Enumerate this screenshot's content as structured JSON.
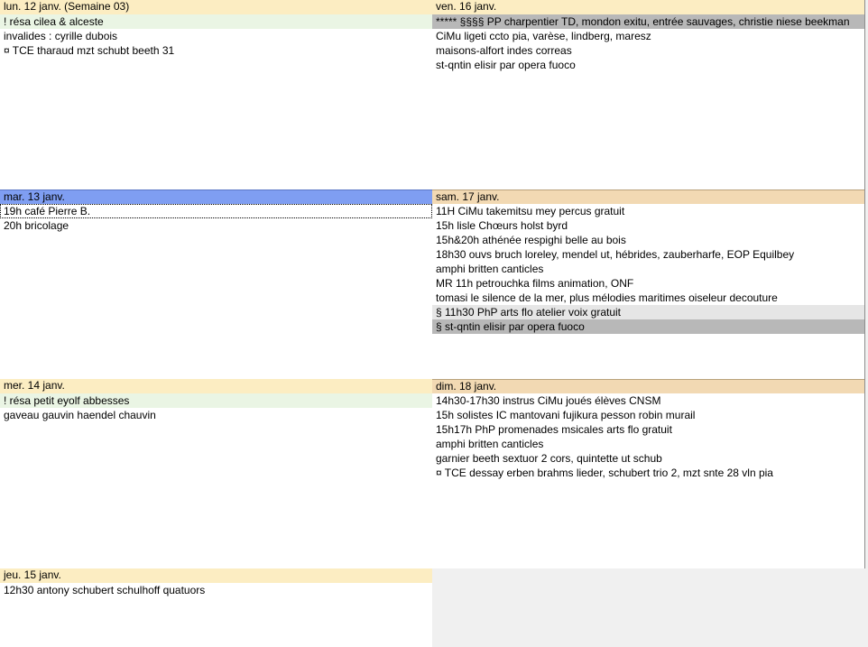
{
  "days": [
    {
      "header": "lun. 12 janv. (Semaine 03)",
      "events": [
        {
          "text": "! résa cilea & alceste",
          "style": "green"
        },
        {
          "text": "invalides : cyrille dubois",
          "style": ""
        },
        {
          "text": "¤ TCE tharaud mzt schubt beeth 31",
          "style": ""
        }
      ]
    },
    {
      "header": "mar. 13 janv.",
      "events": [
        {
          "text": "19h café Pierre B.",
          "style": "selected-ev"
        },
        {
          "text": "20h bricolage",
          "style": ""
        }
      ]
    },
    {
      "header": "mer. 14 janv.",
      "events": [
        {
          "text": "! résa petit eyolf abbesses",
          "style": "green"
        },
        {
          "text": "gaveau gauvin haendel chauvin",
          "style": ""
        }
      ]
    },
    {
      "header": "jeu. 15 janv.",
      "events": [
        {
          "text": "12h30 antony schubert schulhoff quatuors",
          "style": ""
        }
      ]
    },
    {
      "header": "ven. 16 janv.",
      "events": [
        {
          "text": "***** §§§§ PP charpentier TD, mondon exitu, entrée sauvages, christie niese beekman",
          "style": "gray"
        },
        {
          "text": "CiMu ligeti ccto pia, varèse, lindberg, maresz",
          "style": ""
        },
        {
          "text": "maisons-alfort indes correas",
          "style": ""
        },
        {
          "text": "st-qntin elisir par opera fuoco",
          "style": ""
        }
      ]
    },
    {
      "header": "sam. 17 janv.",
      "events": [
        {
          "text": "11H CiMu takemitsu mey percus gratuit",
          "style": ""
        },
        {
          "text": "15h lisle Chœurs holst byrd",
          "style": ""
        },
        {
          "text": "15h&20h athénée respighi belle au bois",
          "style": ""
        },
        {
          "text": "18h30 ouvs bruch loreley, mendel ut, hébrides, zauberharfe, EOP Equilbey",
          "style": ""
        },
        {
          "text": "amphi britten canticles",
          "style": ""
        },
        {
          "text": "MR 11h petrouchka films animation, ONF",
          "style": ""
        },
        {
          "text": "tomasi le silence de la mer, plus mélodies maritimes oiseleur decouture",
          "style": ""
        },
        {
          "text": "§ 11h30 PhP arts flo atelier voix gratuit",
          "style": "lightgray"
        },
        {
          "text": "§ st-qntin elisir par opera fuoco",
          "style": "gray"
        }
      ]
    },
    {
      "header": "dim. 18 janv.",
      "events": [
        {
          "text": "14h30-17h30 instrus CiMu joués élèves CNSM",
          "style": ""
        },
        {
          "text": "15h solistes IC mantovani fujikura pesson robin murail",
          "style": ""
        },
        {
          "text": "15h17h PhP promenades msicales arts flo gratuit",
          "style": ""
        },
        {
          "text": "amphi britten canticles",
          "style": ""
        },
        {
          "text": "garnier beeth sextuor 2 cors, quintette ut schub",
          "style": ""
        },
        {
          "text": "¤ TCE dessay erben brahms lieder, schubert trio 2, mzt snte 28 vln pia",
          "style": ""
        }
      ]
    }
  ]
}
